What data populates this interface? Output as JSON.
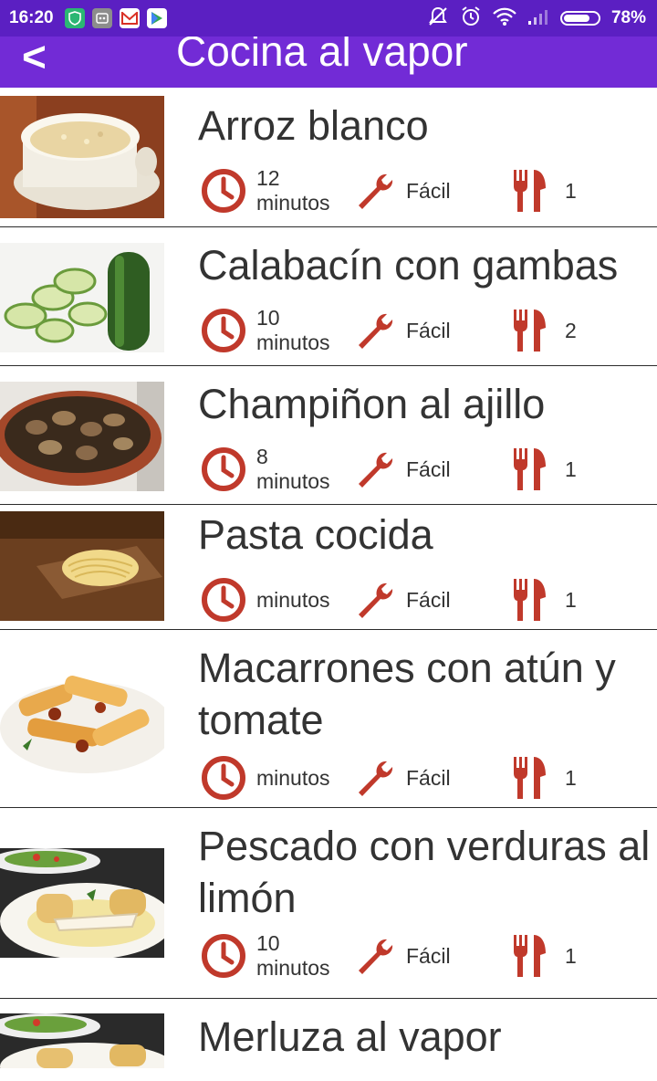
{
  "status_bar": {
    "time": "16:20",
    "battery_percent": "78%",
    "battery_level": 0.78
  },
  "header": {
    "back_label": "<",
    "title": "Cocina al vapor"
  },
  "recipes": [
    {
      "title": "Arroz blanco",
      "time_value": "12",
      "time_unit": "minutos",
      "difficulty": "Fácil",
      "servings": "1"
    },
    {
      "title": "Calabacín con gambas",
      "time_value": "10",
      "time_unit": "minutos",
      "difficulty": "Fácil",
      "servings": "2"
    },
    {
      "title": "Champiñon al ajillo",
      "time_value": "8",
      "time_unit": "minutos",
      "difficulty": "Fácil",
      "servings": "1"
    },
    {
      "title": "Pasta cocida",
      "time_value": "",
      "time_unit": "minutos",
      "difficulty": "Fácil",
      "servings": "1"
    },
    {
      "title": "Macarrones con atún y tomate",
      "time_value": "",
      "time_unit": "minutos",
      "difficulty": "Fácil",
      "servings": "1"
    },
    {
      "title": "Pescado con verduras al limón",
      "time_value": "10",
      "time_unit": "minutos",
      "difficulty": "Fácil",
      "servings": "1"
    },
    {
      "title": "Merluza al vapor",
      "time_value": "",
      "time_unit": "",
      "difficulty": "",
      "servings": ""
    }
  ],
  "colors": {
    "status_bar": "#5b1fc2",
    "app_bar": "#722bd6",
    "icon_red": "#c0392b",
    "divider": "#2b2b2b"
  },
  "icons": {
    "time": "clock-icon",
    "difficulty": "wrench-icon",
    "servings": "cutlery-icon"
  }
}
